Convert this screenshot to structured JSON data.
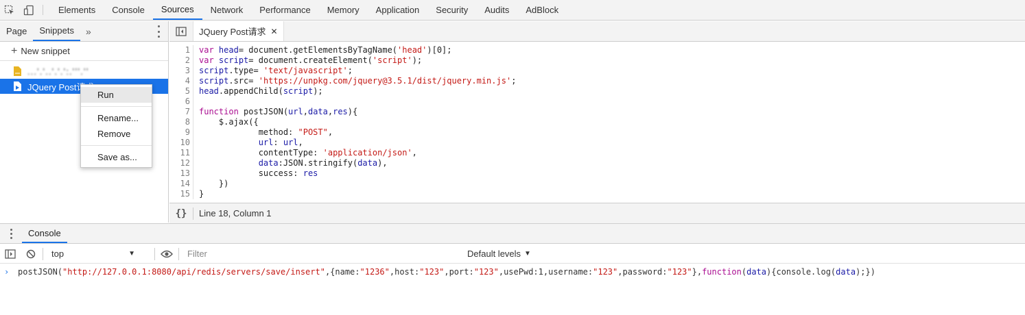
{
  "top_tabs": [
    {
      "label": "Elements"
    },
    {
      "label": "Console"
    },
    {
      "label": "Sources",
      "active": true
    },
    {
      "label": "Network"
    },
    {
      "label": "Performance"
    },
    {
      "label": "Memory"
    },
    {
      "label": "Application"
    },
    {
      "label": "Security"
    },
    {
      "label": "Audits"
    },
    {
      "label": "AdBlock"
    }
  ],
  "navigator": {
    "tabs": [
      {
        "label": "Page"
      },
      {
        "label": "Snippets",
        "active": true
      }
    ],
    "more_label": "»",
    "new_snippet_label": "New snippet",
    "snippets": [
      {
        "label": "...ʻ.ʻ..ʻ.ʻ.ʻ:.ʻʻʻ.ʻʻ",
        "blurred": true
      },
      {
        "label": "JQuery Post请求",
        "selected": true
      }
    ]
  },
  "context_menu": {
    "run": "Run",
    "rename": "Rename...",
    "remove": "Remove",
    "save_as": "Save as..."
  },
  "editor": {
    "tab_label": "JQuery Post请求",
    "close_label": "✕",
    "lines": [
      "var head= document.getElementsByTagName('head')[0];",
      "var script= document.createElement('script');",
      "script.type= 'text/javascript';",
      "script.src= 'https://unpkg.com/jquery@3.5.1/dist/jquery.min.js';",
      "head.appendChild(script);",
      "",
      "function postJSON(url,data,res){",
      "    $.ajax({",
      "            method: \"POST\",",
      "            url: url,",
      "            contentType: 'application/json',",
      "            data:JSON.stringify(data),",
      "            success: res",
      "    })",
      "}"
    ],
    "status_braces": "{}",
    "status_position": "Line 18, Column 1"
  },
  "drawer": {
    "tab_label": "Console",
    "context_value": "top",
    "filter_placeholder": "Filter",
    "levels_label": "Default levels",
    "input_line": "postJSON(\"http://127.0.0.1:8080/api/redis/servers/save/insert\",{name:\"1236\",host:\"123\",port:\"123\",usePwd:1,username:\"123\",password:\"123\"},function(data){console.log(data);})"
  },
  "colors": {
    "accent": "#1a73e8",
    "keyword": "#aa0d91",
    "string": "#c41a16"
  }
}
